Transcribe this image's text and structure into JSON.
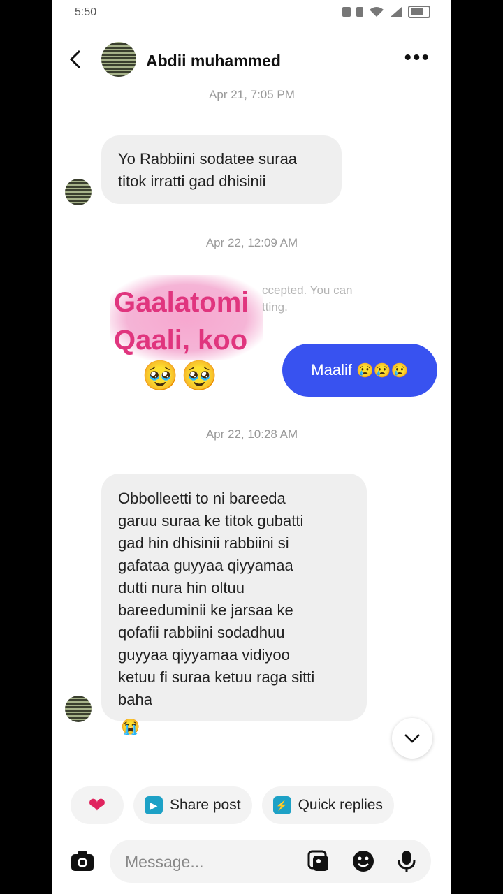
{
  "status": {
    "time": "5:50"
  },
  "header": {
    "name": "Abdii muhammed",
    "more": "•••"
  },
  "messages": {
    "ts1": "Apr 21, 7:05 PM",
    "msg1": "Yo Rabbiini sodatee suraa\ntitok irratti gad dhisinii",
    "ts2": "Apr 22, 12:09 AM",
    "sticker": "Gaalatomi\nQaali, koo",
    "faded_note": "ccepted. You can\ntting.",
    "outgoing": "Maalif",
    "outgoing_emoji": "😢😢😢",
    "sticker_emoji_1": "🥹",
    "sticker_emoji_2": "🥹",
    "ts3": "Apr 22, 10:28 AM",
    "msg2": "Obbolleetti to ni bareeda\ngaruu suraa ke titok gubatti\ngad hin dhisinii rabbiini si\ngafataa guyyaa qiyyamaa\ndutti nura hin oltuu\nbareeduminii ke jarsaa ke\nqofafii rabbiini sodadhuu\nguyyaa qiyyamaa vidiyoo\nketuu fi suraa ketuu raga sitti\nbaha",
    "reaction": "😭"
  },
  "chips": {
    "share": "Share post",
    "quick": "Quick replies"
  },
  "composer": {
    "placeholder": "Message..."
  },
  "colors": {
    "accent": "#3852f0",
    "sticker_text": "#e0357e"
  }
}
